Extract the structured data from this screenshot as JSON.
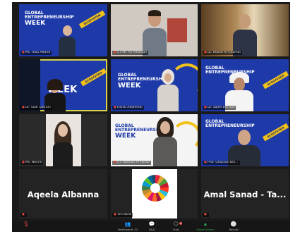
{
  "window": {
    "bg": "#1a1a1a"
  },
  "colors": {
    "banner_blue": "#1e3aa8",
    "banner_yellow": "#f2c21b",
    "active_outline": "#d9d24a",
    "toolbar": "#161616"
  },
  "tiles": [
    {
      "name": "Ms. Hala Alfarid",
      "banner": true
    },
    {
      "name": "CT Mr. Ali Alhaidari",
      "banner": false
    },
    {
      "name": "Dr. Khalid Al-Ghamdi",
      "banner": false
    },
    {
      "name": "Dr. Sadr Dibrani",
      "banner": true
    },
    {
      "name": "Hanal Alfahmidi",
      "banner": true
    },
    {
      "name": "Dr. Saleh Bin Sak",
      "banner": true
    },
    {
      "name": "Ms. Nesrin",
      "banner": false
    },
    {
      "name": "CT Yatmani Al Fahad",
      "banner": true
    },
    {
      "name": "Prof. Ghassan Bin...",
      "banner": true
    },
    {
      "name": "",
      "display": "Aqeela Albanna"
    },
    {
      "name": "Ten Bank",
      "banner": false
    },
    {
      "name": "",
      "display": "Amal Sanad - Ta..."
    }
  ],
  "banner": {
    "line1": "GLOBAL",
    "line2": "ENTREPRENEURSHIP",
    "line3": "WEEK",
    "ribbon": "ECOSYSTEM"
  },
  "toolbar": {
    "participants": {
      "label": "Participants",
      "count": "32"
    },
    "qa": {
      "label": "Q&A"
    },
    "chat": {
      "label": "Chat",
      "badge": "2"
    },
    "share": {
      "label": "Share Screen"
    },
    "record": {
      "label": "Record"
    }
  }
}
